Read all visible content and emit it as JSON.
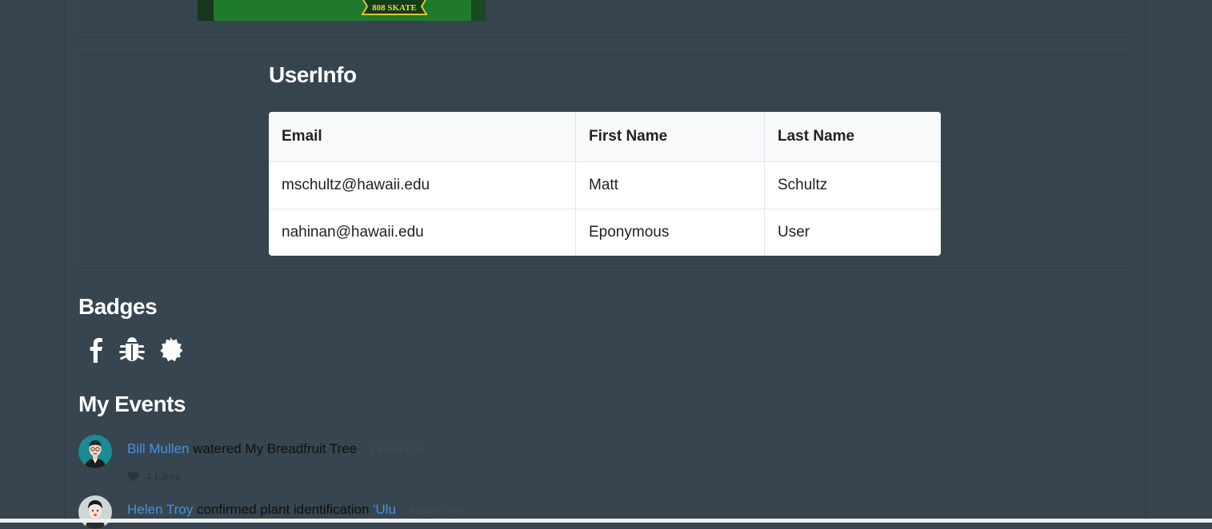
{
  "user_info": {
    "title": "UserInfo",
    "columns": [
      "Email",
      "First Name",
      "Last Name"
    ],
    "rows": [
      [
        "mschultz@hawaii.edu",
        "Matt",
        "Schultz"
      ],
      [
        "nahinan@hawaii.edu",
        "Eponymous",
        "User"
      ]
    ]
  },
  "banner": {
    "badge_text": "808 SKATE"
  },
  "badges": {
    "title": "Badges",
    "icons": [
      "facebook-icon",
      "bug-icon",
      "certificate-icon"
    ]
  },
  "events": {
    "title": "My Events",
    "items": [
      {
        "user": "Bill Mullen",
        "action": "watered My Breadfruit Tree",
        "target": "",
        "time": "1 Hour Ago",
        "likes": "4 Likes"
      },
      {
        "user": "Helen Troy",
        "action": "confirmed plant identification",
        "target": "'Ulu",
        "time": "4 days ago"
      }
    ]
  },
  "colors": {
    "background": "#36454f",
    "link": "#4a90e2",
    "table_header_bg": "#f8f9fa"
  }
}
